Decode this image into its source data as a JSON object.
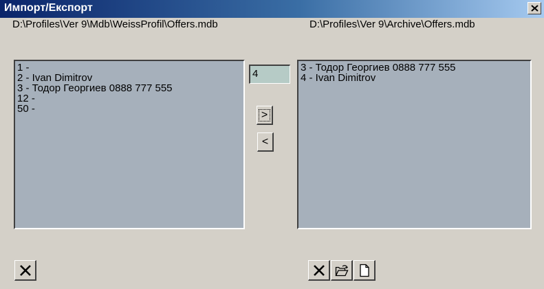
{
  "window": {
    "title": "Импорт/Експорт",
    "close_icon": "close-icon"
  },
  "paths": {
    "source": "D:\\Profiles\\Ver 9\\Mdb\\WeissProfil\\Offers.mdb",
    "target": "D:\\Profiles\\Ver 9\\Archive\\Offers.mdb"
  },
  "source_list": {
    "items": [
      "1 -",
      "2 - Ivan Dimitrov",
      "3 - Тодор Георгиев 0888 777 555",
      "12 -",
      "50 -"
    ]
  },
  "target_list": {
    "items": [
      "3 - Тодор Георгиев 0888 777 555",
      "4 - Ivan Dimitrov"
    ]
  },
  "count_box": {
    "value": "4"
  },
  "transfer": {
    "move_right_label": ">",
    "move_left_label": "<"
  },
  "toolbar_left": {
    "delete_icon": "delete-icon"
  },
  "toolbar_right": {
    "delete_icon": "delete-icon",
    "open_icon": "open-folder-icon",
    "new_icon": "new-document-icon"
  },
  "colors": {
    "list_background": "#a6b0bb",
    "count_box_background": "#b6cbc6",
    "titlebar_start": "#0a246a",
    "titlebar_end": "#a6caf0",
    "window_face": "#d4d0c8"
  }
}
